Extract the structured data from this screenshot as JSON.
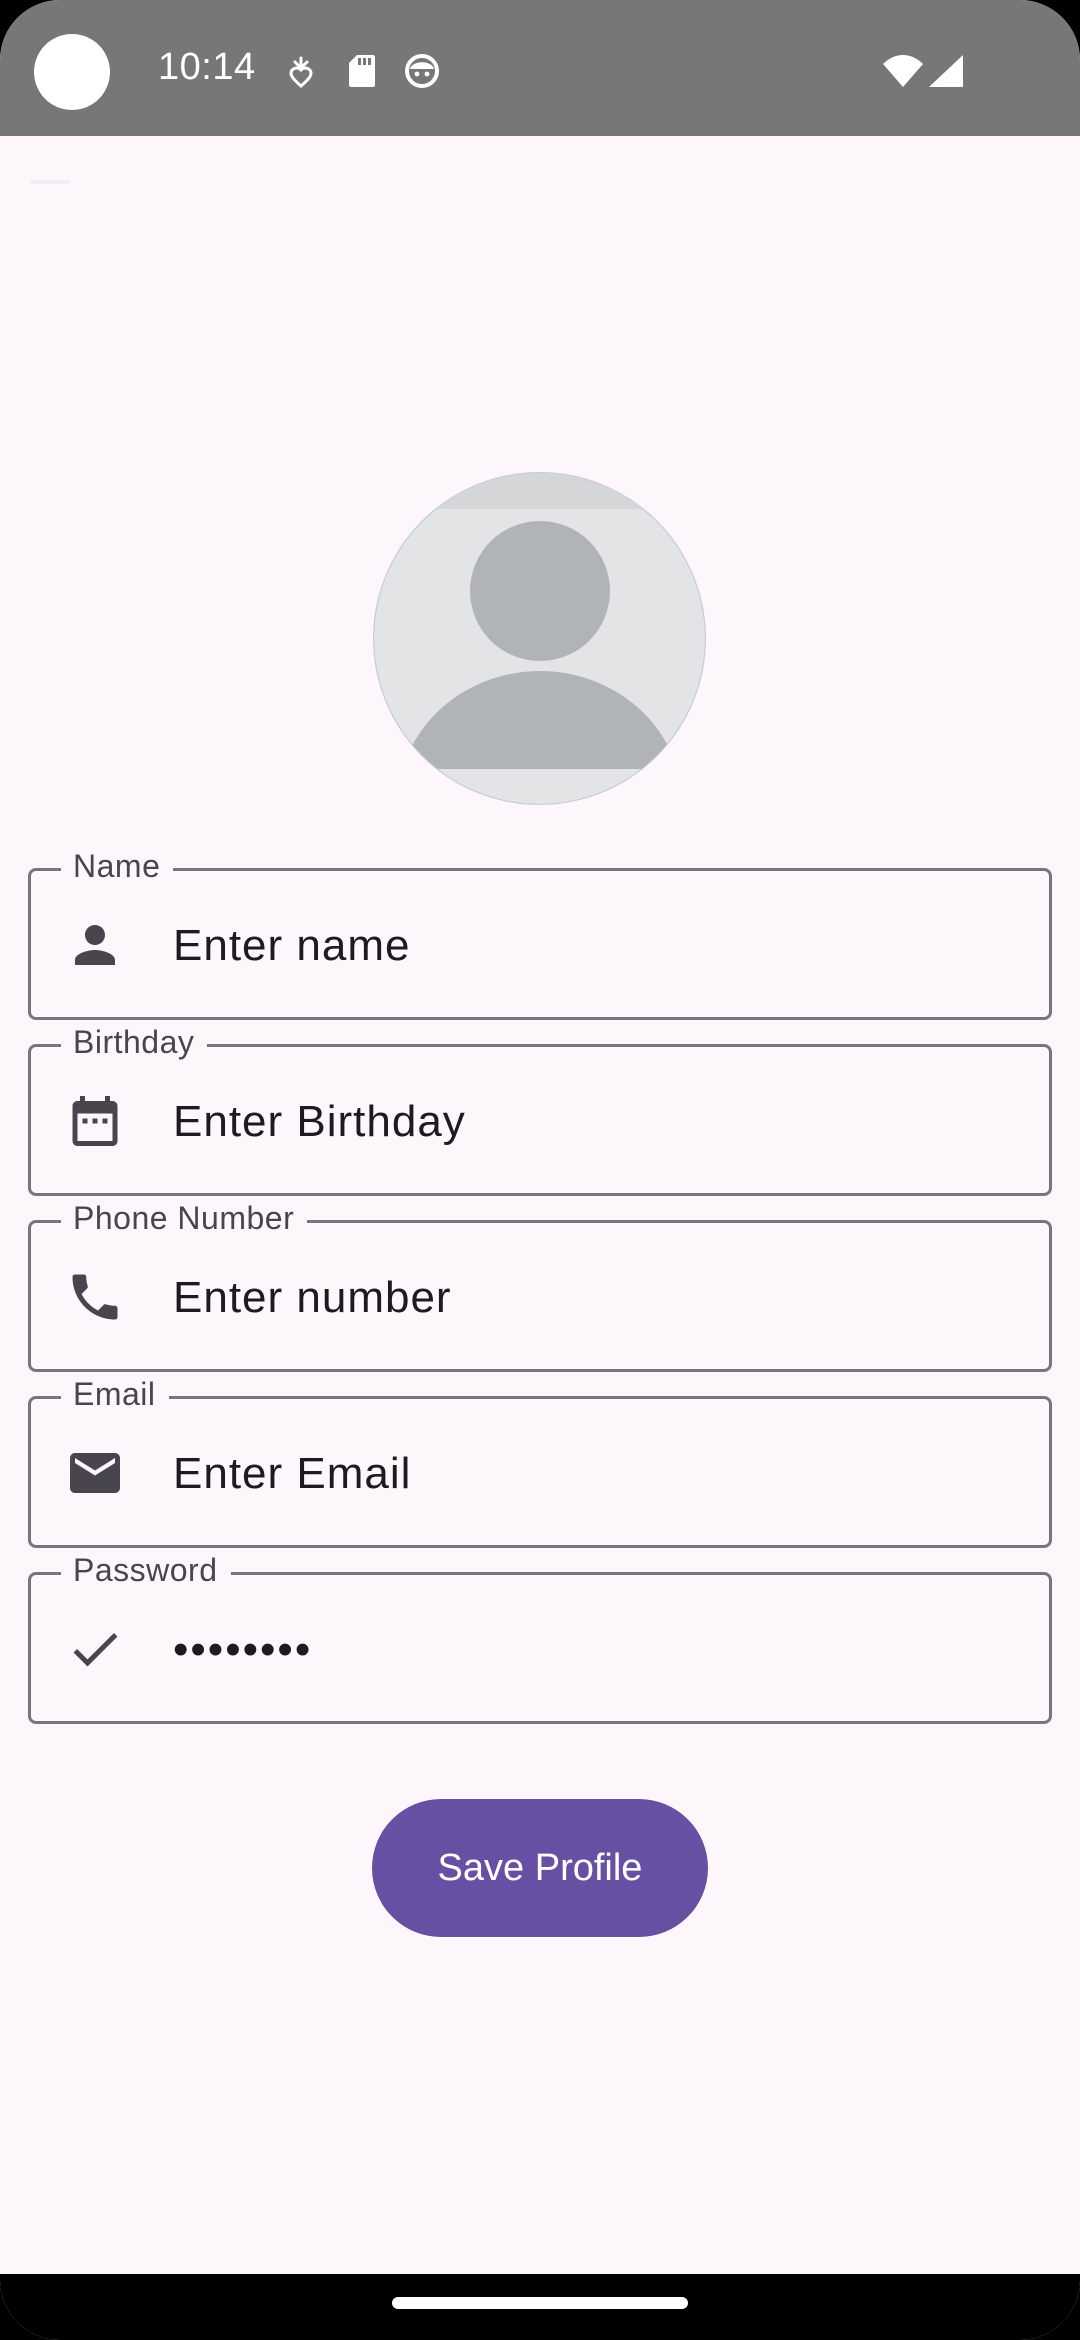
{
  "status_bar": {
    "time": "10:14",
    "icons": [
      "location-heart-icon",
      "sd-card-icon",
      "face-icon",
      "wifi-icon",
      "cell-signal-icon"
    ]
  },
  "avatar": {
    "icon": "person-avatar-placeholder"
  },
  "fields": [
    {
      "label": "Name",
      "placeholder": "Enter name",
      "icon": "person-icon"
    },
    {
      "label": "Birthday",
      "placeholder": "Enter Birthday",
      "icon": "calendar-icon"
    },
    {
      "label": "Phone Number",
      "placeholder": "Enter number",
      "icon": "phone-icon"
    },
    {
      "label": "Email",
      "placeholder": "Enter Email",
      "icon": "mail-icon"
    },
    {
      "label": "Password",
      "value": "••••••••",
      "icon": "check-icon"
    }
  ],
  "save_button": {
    "label": "Save Profile"
  },
  "colors": {
    "background": "#FDF7FB",
    "status_bar": "#777777",
    "primary": "#6750A4",
    "outline": "#79747E",
    "label": "#49454F",
    "text": "#1D1B20",
    "icon": "#49454F",
    "avatar_bg": "#E2E4E6",
    "avatar_figure": "#B0B4B8"
  }
}
